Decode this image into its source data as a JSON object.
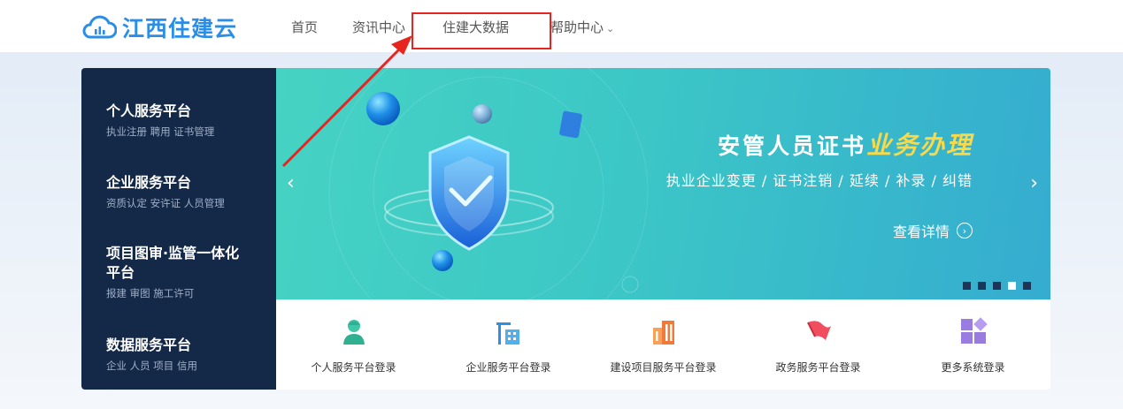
{
  "header": {
    "logo_text": "江西住建云",
    "nav": [
      {
        "label": "首页"
      },
      {
        "label": "资讯中心"
      },
      {
        "label": "住建大数据"
      },
      {
        "label": "帮助中心"
      }
    ]
  },
  "sidebar": {
    "items": [
      {
        "title": "个人服务平台",
        "sub": "执业注册  聘用  证书管理"
      },
      {
        "title": "企业服务平台",
        "sub": "资质认定  安许证  人员管理"
      },
      {
        "title": "项目图审·监管一体化平台",
        "sub": "报建  审图  施工许可"
      },
      {
        "title": "数据服务平台",
        "sub": "企业  人员  项目  信用"
      }
    ]
  },
  "banner": {
    "title_main": "安管人员证书",
    "title_accent": "业务办理",
    "subtitle": "执业企业变更 / 证书注销 / 延续 / 补录 / 纠错",
    "link_label": "查看详情",
    "slide_count": 5,
    "active_slide": 4
  },
  "login_bar": {
    "items": [
      {
        "label": "个人服务平台登录",
        "icon": "person-icon"
      },
      {
        "label": "企业服务平台登录",
        "icon": "crane-building-icon"
      },
      {
        "label": "建设项目服务平台登录",
        "icon": "buildings-icon"
      },
      {
        "label": "政务服务平台登录",
        "icon": "flag-icon"
      },
      {
        "label": "更多系统登录",
        "icon": "grid-icon"
      }
    ]
  },
  "colors": {
    "brand": "#2a8ee8",
    "sidebar_bg": "#142848",
    "annotation": "#e8241f"
  }
}
